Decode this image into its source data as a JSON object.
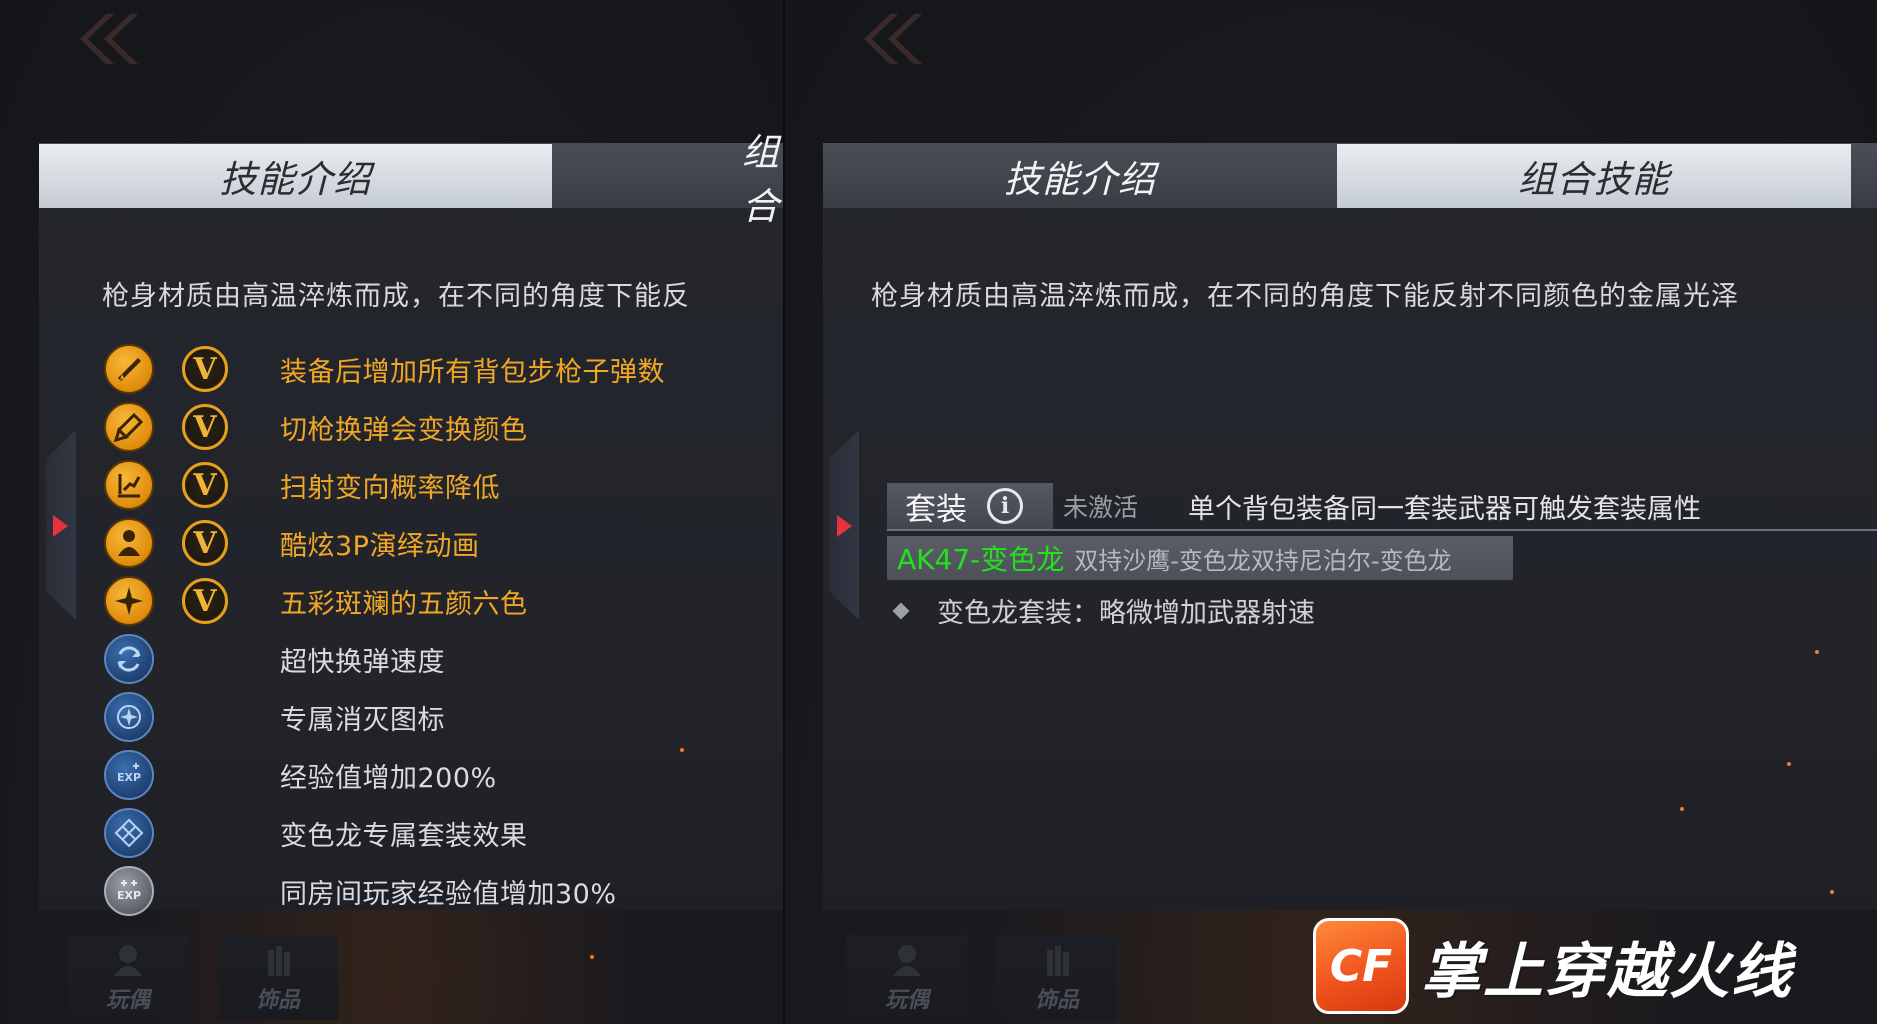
{
  "colors": {
    "accent_gold": "#f1a726",
    "weapon_green": "#21e21b",
    "tab_active_bg": "#dfe3e8",
    "arrow_red": "#e8323d"
  },
  "left": {
    "tabs": [
      {
        "label": "技能介绍",
        "active": true
      },
      {
        "label": "组合",
        "active": false
      }
    ],
    "description": "枪身材质由高温淬炼而成，在不同的角度下能反",
    "skills": [
      {
        "icon": "rifle-icon",
        "style": "gold",
        "vip": "V",
        "text": "装备后增加所有背包步枪子弹数"
      },
      {
        "icon": "paint-brush-icon",
        "style": "gold",
        "vip": "V",
        "text": "切枪换弹会变换颜色"
      },
      {
        "icon": "spray-pattern-icon",
        "style": "gold",
        "vip": "V",
        "text": "扫射变向概率降低"
      },
      {
        "icon": "third-person-icon",
        "style": "gold",
        "vip": "V",
        "text": "酷炫3P演绎动画"
      },
      {
        "icon": "sparkle-icon",
        "style": "gold",
        "vip": "V",
        "text": "五彩斑斓的五颜六色"
      },
      {
        "icon": "fast-reload-icon",
        "style": "blue",
        "vip": "",
        "text": "超快换弹速度"
      },
      {
        "icon": "kill-mark-icon",
        "style": "blue",
        "vip": "",
        "text": "专属消灭图标"
      },
      {
        "icon": "exp-up-icon",
        "style": "blue",
        "vip": "",
        "text": "经验值增加200%"
      },
      {
        "icon": "diamond-set-icon",
        "style": "blue",
        "vip": "",
        "text": "变色龙专属套装效果"
      },
      {
        "icon": "room-exp-icon",
        "style": "grey",
        "vip": "",
        "text": "同房间玩家经验值增加30%"
      }
    ],
    "nav": [
      "玩偶",
      "饰品"
    ]
  },
  "right": {
    "tabs": [
      {
        "label": "技能介绍",
        "active": false
      },
      {
        "label": "组合技能",
        "active": true
      }
    ],
    "description": "枪身材质由高温淬炼而成，在不同的角度下能反射不同颜色的金属光泽",
    "set": {
      "label": "套装",
      "status": "未激活",
      "rule": "单个背包装备同一套装武器可触发套装属性"
    },
    "weapons": {
      "main": "AK47-变色龙",
      "others": "双持沙鹰-变色龙双持尼泊尔-变色龙"
    },
    "bonus": "变色龙套装：略微增加武器射速",
    "nav": [
      "玩偶",
      "饰品"
    ]
  },
  "logo": {
    "badge": "CF",
    "text": "掌上穿越火线"
  }
}
